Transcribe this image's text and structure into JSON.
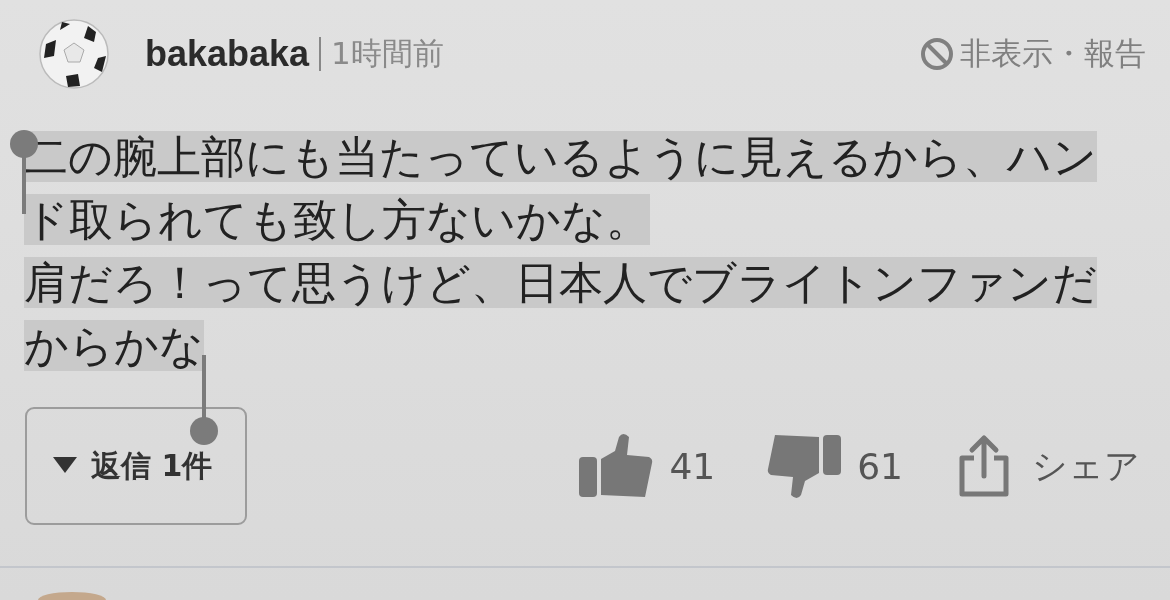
{
  "comment": {
    "author": "bakabaka",
    "time": "1時間前",
    "hide_report": "非表示・報告",
    "paragraphs": [
      "二の腕上部にも当たっているように見えるから、ハンド取られても致し方ないかな。",
      "肩だろ！って思うけど、日本人でブライトンファンだからかな"
    ],
    "text_selected": true
  },
  "replies_button": {
    "label": "返信 1件",
    "expanded": false
  },
  "likes": "41",
  "dislikes": "61",
  "share": "シェア"
}
